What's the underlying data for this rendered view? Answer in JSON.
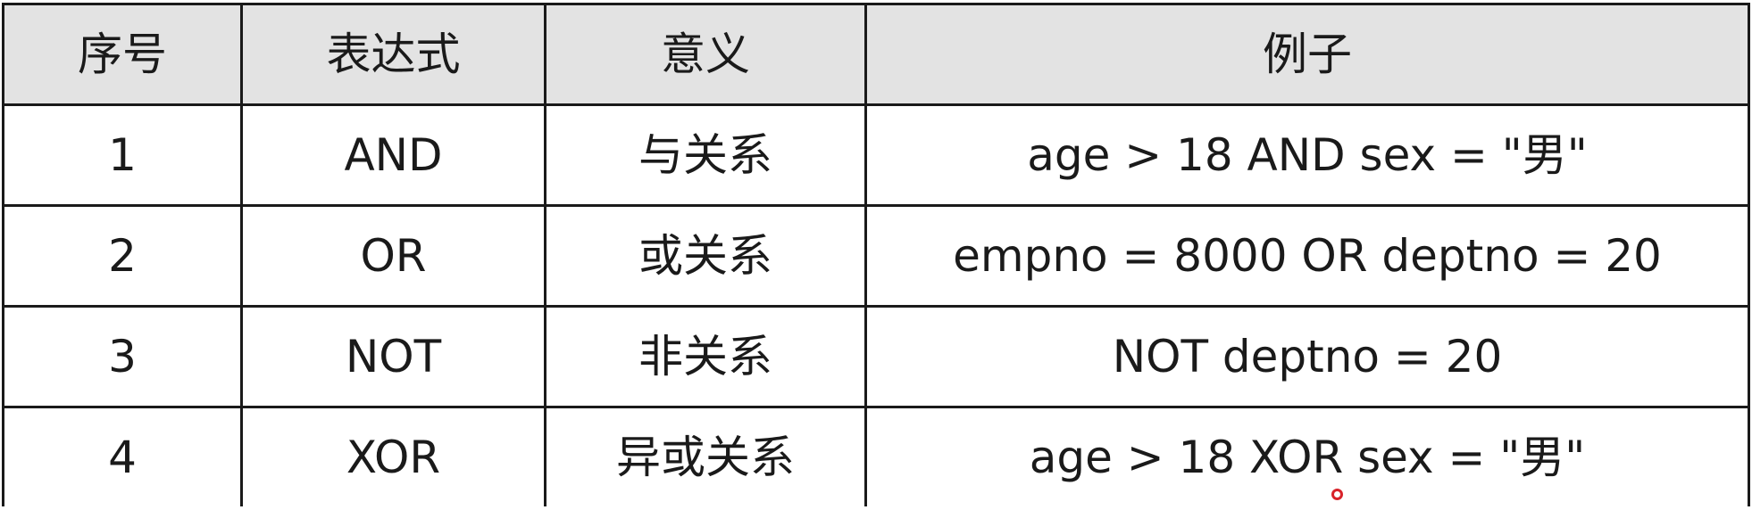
{
  "table": {
    "headers": [
      "序号",
      "表达式",
      "意义",
      "例子"
    ],
    "rows": [
      [
        "1",
        "AND",
        "与关系",
        "age > 18 AND sex = \"男\""
      ],
      [
        "2",
        "OR",
        "或关系",
        "empno = 8000 OR deptno = 20"
      ],
      [
        "3",
        "NOT",
        "非关系",
        "NOT deptno = 20"
      ],
      [
        "4",
        "XOR",
        "异或关系",
        "age > 18 XOR sex = \"男\""
      ]
    ]
  },
  "colors": {
    "header_bg": "#e3e3e3",
    "border": "#1a1a1a",
    "cursor_ring": "#d8232a"
  }
}
